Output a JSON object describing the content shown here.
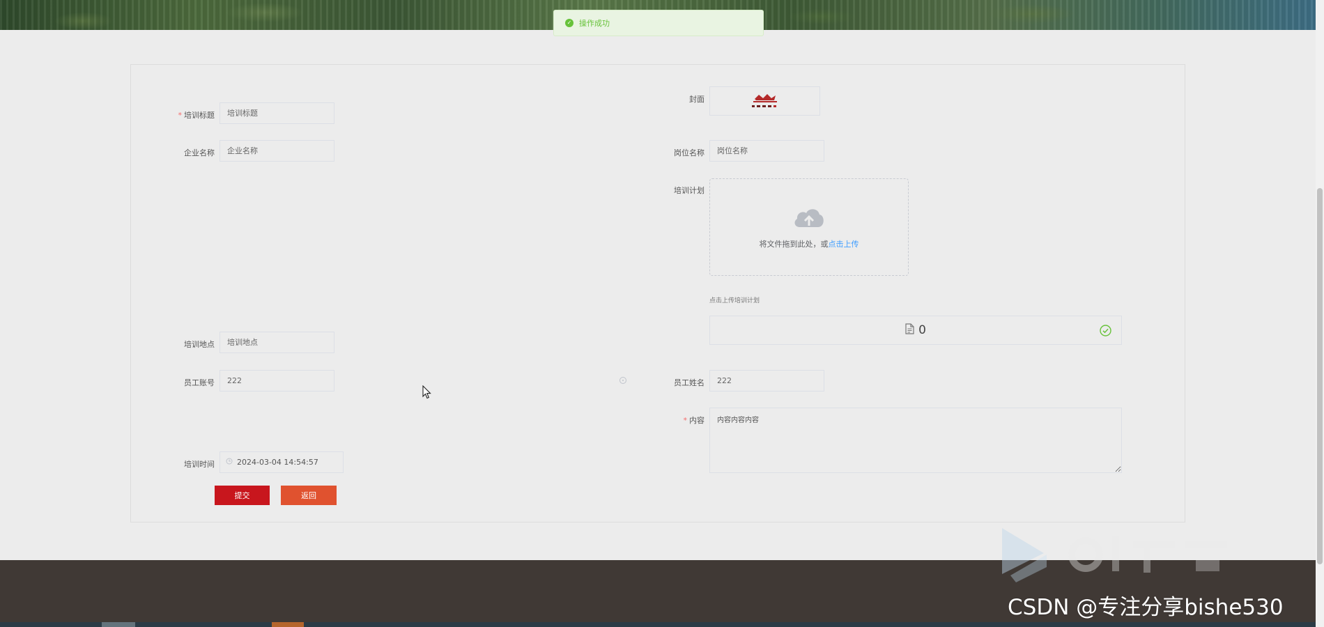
{
  "toast": {
    "message": "操作成功"
  },
  "form": {
    "title_label": "培训标题",
    "title_placeholder": "培训标题",
    "company_label": "企业名称",
    "company_placeholder": "企业名称",
    "location_label": "培训地点",
    "location_placeholder": "培训地点",
    "employee_account_label": "员工账号",
    "employee_account_value": "222",
    "training_time_label": "培训时间",
    "training_time_value": "2024-03-04 14:54:57",
    "cover_label": "封面",
    "position_label": "岗位名称",
    "position_placeholder": "岗位名称",
    "plan_label": "培训计划",
    "upload_text": "将文件拖到此处，或",
    "upload_link": "点击上传",
    "upload_tip": "点击上传培训计划",
    "uploaded_file_name": "0",
    "employee_name_label": "员工姓名",
    "employee_name_value": "222",
    "content_label": "内容",
    "content_value": "内容内容内容",
    "submit_label": "提交",
    "back_label": "返回"
  },
  "watermark": {
    "text": "CSDN @专注分享bishe530"
  },
  "colors": {
    "accent_red": "#c8161d",
    "back_orange": "#e0522f",
    "success_green": "#67c23a",
    "link_blue": "#409eff",
    "footer_bg": "#403935"
  }
}
